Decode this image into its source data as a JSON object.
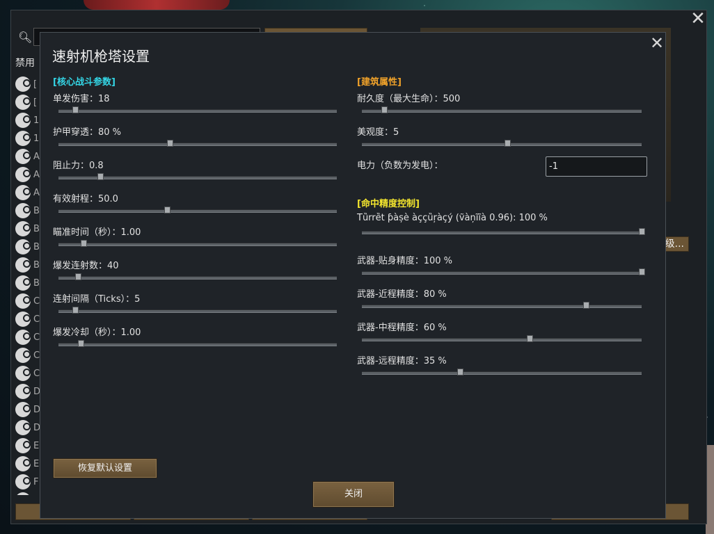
{
  "back_window": {
    "filter_label": "禁用",
    "level_button_label": "级...",
    "list_letters": [
      "[",
      "[",
      "1",
      "1",
      "A",
      "A",
      "A",
      "B",
      "B",
      "B",
      "B",
      "B",
      "C",
      "C",
      "C",
      "C",
      "C",
      "D",
      "D",
      "D",
      "E",
      "E",
      "F",
      ""
    ]
  },
  "dialog": {
    "title": "速射机枪塔设置",
    "reset_button": "恢复默认设置",
    "close_button": "关闭"
  },
  "left_column": {
    "header": "[核心战斗参数]",
    "settings": [
      {
        "label": "单发伤害：18",
        "value": 0.06
      },
      {
        "label": "护甲穿透：80 %",
        "value": 0.4
      },
      {
        "label": "阻止力：0.8",
        "value": 0.15
      },
      {
        "label": "有效射程：50.0",
        "value": 0.39
      },
      {
        "label": "瞄准时间（秒）：1.00",
        "value": 0.09
      },
      {
        "label": "爆发连射数：40",
        "value": 0.07
      },
      {
        "label": "连射间隔（Ticks）：5",
        "value": 0.06
      },
      {
        "label": "爆发冷却（秒）：1.00",
        "value": 0.08
      }
    ]
  },
  "right_column": {
    "building_header": "[建筑属性]",
    "building_settings": [
      {
        "label": "耐久度（最大生命）：500",
        "value": 0.08
      },
      {
        "label": "美观度：5",
        "value": 0.52
      }
    ],
    "power_label": "电力（负数为发电）：",
    "power_value": "-1",
    "accuracy_header": "[命中精度控制]",
    "accuracy_settings": [
      {
        "label": "Tȕrrȅt ƥàșè àççȕŗàçý (ṽàņĩĩà 0.96): 100 %",
        "value": 1.0
      },
      {
        "label": "武器-贴身精度：100 %",
        "value": 1.0
      },
      {
        "label": "武器-近程精度：80 %",
        "value": 0.8
      },
      {
        "label": "武器-中程精度：60 %",
        "value": 0.6
      },
      {
        "label": "武器-远程精度：35 %",
        "value": 0.35
      }
    ]
  }
}
